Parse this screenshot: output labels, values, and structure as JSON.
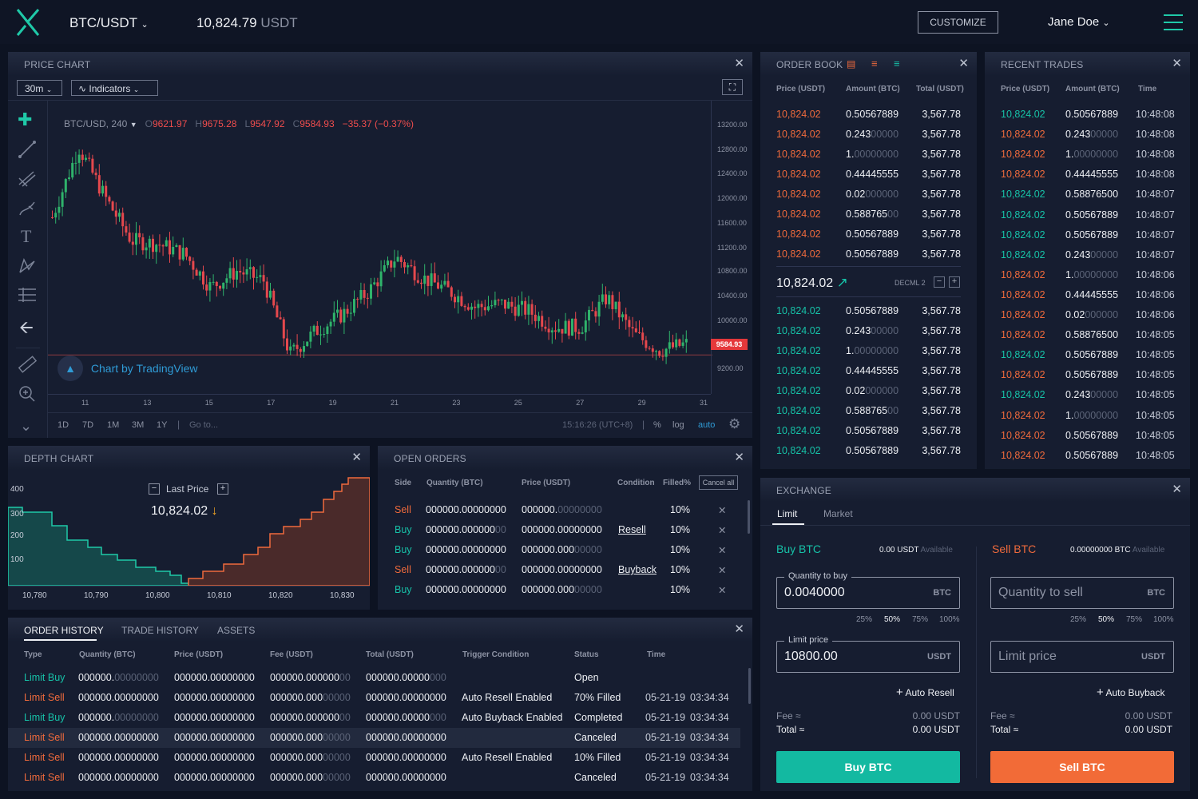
{
  "topbar": {
    "pair": "BTC/USDT",
    "price": "10,824.79",
    "currency": "USDT",
    "customize": "CUSTOMIZE",
    "user": "Jane Doe"
  },
  "price_chart": {
    "title": "PRICE CHART",
    "interval": "30m",
    "indicators": "Indicators",
    "symbol": "BTC/USD, 240",
    "o_label": "O",
    "o": "9621.97",
    "h_label": "H",
    "h": "9675.28",
    "l_label": "L",
    "l": "9547.92",
    "c_label": "C",
    "c": "9584.93",
    "change": "−35.37 (−0.37%)",
    "last_tag": "9584.93",
    "watermark": "Chart by TradingView",
    "ranges": [
      "1D",
      "7D",
      "1M",
      "3M",
      "1Y"
    ],
    "goto": "Go to...",
    "time": "15:16:26 (UTC+8)",
    "pct": "%",
    "log": "log",
    "auto": "auto",
    "y_ticks": [
      "13200.00",
      "12800.00",
      "12400.00",
      "12000.00",
      "11600.00",
      "11200.00",
      "10800.00",
      "10400.00",
      "10000.00",
      "9200.00"
    ],
    "x_ticks": [
      "11",
      "13",
      "15",
      "17",
      "19",
      "21",
      "23",
      "25",
      "27",
      "29",
      "31"
    ]
  },
  "order_book": {
    "title": "ORDER BOOK",
    "headers": [
      "Price (USDT)",
      "Amount (BTC)",
      "Total (USDT)"
    ],
    "asks": [
      [
        "10,824.02",
        "0.50567889",
        "",
        "3,567.78"
      ],
      [
        "10,824.02",
        "0.243",
        "00000",
        "3,567.78"
      ],
      [
        "10,824.02",
        "1.",
        "00000000",
        "3,567.78"
      ],
      [
        "10,824.02",
        "0.44445555",
        "",
        "3,567.78"
      ],
      [
        "10,824.02",
        "0.02",
        "000000",
        "3,567.78"
      ],
      [
        "10,824.02",
        "0.588765",
        "00",
        "3,567.78"
      ],
      [
        "10,824.02",
        "0.50567889",
        "",
        "3,567.78"
      ],
      [
        "10,824.02",
        "0.50567889",
        "",
        "3,567.78"
      ]
    ],
    "mid": "10,824.02",
    "decimal": "DECML 2",
    "bids": [
      [
        "10,824.02",
        "0.50567889",
        "",
        "3,567.78"
      ],
      [
        "10,824.02",
        "0.243",
        "00000",
        "3,567.78"
      ],
      [
        "10,824.02",
        "1.",
        "00000000",
        "3,567.78"
      ],
      [
        "10,824.02",
        "0.44445555",
        "",
        "3,567.78"
      ],
      [
        "10,824.02",
        "0.02",
        "000000",
        "3,567.78"
      ],
      [
        "10,824.02",
        "0.588765",
        "00",
        "3,567.78"
      ],
      [
        "10,824.02",
        "0.50567889",
        "",
        "3,567.78"
      ],
      [
        "10,824.02",
        "0.50567889",
        "",
        "3,567.78"
      ]
    ]
  },
  "recent_trades": {
    "title": "RECENT TRADES",
    "headers": [
      "Price (USDT)",
      "Amount (BTC)",
      "Time"
    ],
    "rows": [
      [
        "g",
        "10,824.02",
        "0.50567889",
        "",
        "10:48:08"
      ],
      [
        "r",
        "10,824.02",
        "0.243",
        "00000",
        "10:48:08"
      ],
      [
        "r",
        "10,824.02",
        "1.",
        "00000000",
        "10:48:08"
      ],
      [
        "r",
        "10,824.02",
        "0.44445555",
        "",
        "10:48:08"
      ],
      [
        "g",
        "10,824.02",
        "0.58876500",
        "",
        "10:48:07"
      ],
      [
        "g",
        "10,824.02",
        "0.50567889",
        "",
        "10:48:07"
      ],
      [
        "g",
        "10,824.02",
        "0.50567889",
        "",
        "10:48:07"
      ],
      [
        "g",
        "10,824.02",
        "0.243",
        "00000",
        "10:48:07"
      ],
      [
        "r",
        "10,824.02",
        "1.",
        "00000000",
        "10:48:06"
      ],
      [
        "r",
        "10,824.02",
        "0.44445555",
        "",
        "10:48:06"
      ],
      [
        "r",
        "10,824.02",
        "0.02",
        "000000",
        "10:48:06"
      ],
      [
        "r",
        "10,824.02",
        "0.58876500",
        "",
        "10:48:05"
      ],
      [
        "g",
        "10,824.02",
        "0.50567889",
        "",
        "10:48:05"
      ],
      [
        "r",
        "10,824.02",
        "0.50567889",
        "",
        "10:48:05"
      ],
      [
        "g",
        "10,824.02",
        "0.243",
        "00000",
        "10:48:05"
      ],
      [
        "r",
        "10,824.02",
        "1.",
        "00000000",
        "10:48:05"
      ],
      [
        "r",
        "10,824.02",
        "0.50567889",
        "",
        "10:48:05"
      ],
      [
        "r",
        "10,824.02",
        "0.50567889",
        "",
        "10:48:05"
      ]
    ]
  },
  "depth_chart": {
    "title": "DEPTH CHART",
    "last_label": "Last Price",
    "last": "10,824.02",
    "y_ticks": [
      "400",
      "300",
      "200",
      "100"
    ],
    "x_ticks": [
      "10,780",
      "10,790",
      "10,800",
      "10,810",
      "10,820",
      "10,830"
    ]
  },
  "open_orders": {
    "title": "OPEN ORDERS",
    "headers": [
      "Side",
      "Quantity (BTC)",
      "Price (USDT)",
      "Condition",
      "Filled%"
    ],
    "cancel_all": "Cancel all",
    "rows": [
      [
        "Sell",
        "000000.00000000",
        "",
        "000000.",
        "00000000",
        "",
        "10%"
      ],
      [
        "Buy",
        "000000.000000",
        "00",
        "000000.00000000",
        "",
        "Resell",
        "10%"
      ],
      [
        "Buy",
        "000000.00000000",
        "",
        "000000.000",
        "00000",
        "",
        "10%"
      ],
      [
        "Sell",
        "000000.000000",
        "00",
        "000000.00000000",
        "",
        "Buyback",
        "10%"
      ],
      [
        "Buy",
        "000000.00000000",
        "",
        "000000.000",
        "00000",
        "",
        "10%"
      ]
    ]
  },
  "history": {
    "tabs": [
      "ORDER HISTORY",
      "TRADE HISTORY",
      "ASSETS"
    ],
    "headers": [
      "Type",
      "Quantity (BTC)",
      "Price (USDT)",
      "Fee (USDT)",
      "Total (USDT)",
      "Trigger Condition",
      "Status",
      "Time"
    ],
    "rows": [
      [
        "g",
        "Limit Buy",
        "000000.",
        "00000000",
        "000000.00000000",
        "",
        "000000.000000",
        "00",
        "000000.00000",
        "000",
        "",
        "Open",
        "",
        ""
      ],
      [
        "r",
        "Limit Sell",
        "000000.00000000",
        "",
        "000000.00000000",
        "",
        "000000.000",
        "00000",
        "000000.00000000",
        "",
        "Auto Resell Enabled",
        "70% Filled",
        "05-21-19",
        "03:34:34"
      ],
      [
        "g",
        "Limit Buy",
        "000000.",
        "00000000",
        "000000.00000000",
        "",
        "000000.000000",
        "00",
        "000000.00000",
        "000",
        "Auto Buyback Enabled",
        "Completed",
        "05-21-19",
        "03:34:34"
      ],
      [
        "r",
        "Limit Sell",
        "000000.00000000",
        "",
        "000000.00000000",
        "",
        "000000.000",
        "00000",
        "000000.00000000",
        "",
        "",
        "Canceled",
        "05-21-19",
        "03:34:34"
      ],
      [
        "r",
        "Limit Sell",
        "000000.00000000",
        "",
        "000000.00000000",
        "",
        "000000.000",
        "00000",
        "000000.00000000",
        "",
        "Auto Resell Enabled",
        "10% Filled",
        "05-21-19",
        "03:34:34"
      ],
      [
        "r",
        "Limit Sell",
        "000000.00000000",
        "",
        "000000.00000000",
        "",
        "000000.000",
        "00000",
        "000000.00000000",
        "",
        "",
        "Canceled",
        "05-21-19",
        "03:34:34"
      ]
    ]
  },
  "exchange": {
    "title": "EXCHANGE",
    "tabs": [
      "Limit",
      "Market"
    ],
    "buy": {
      "title": "Buy BTC",
      "avail": "0.00 USDT",
      "avail_label": "Available",
      "qty_label": "Quantity to buy",
      "qty": "0.0040000",
      "qty_unit": "BTC",
      "pcts": [
        "25%",
        "50%",
        "75%",
        "100%"
      ],
      "price_label": "Limit price",
      "price": "10800.00",
      "price_unit": "USDT",
      "auto": "Auto Resell",
      "fee_label": "Fee ≈",
      "fee": "0.00 USDT",
      "total_label": "Total ≈",
      "total": "0.00 USDT",
      "button": "Buy BTC"
    },
    "sell": {
      "title": "Sell BTC",
      "avail": "0.00000000 BTC",
      "avail_label": "Available",
      "qty_placeholder": "Quantity to sell",
      "qty_unit": "BTC",
      "pcts": [
        "25%",
        "50%",
        "75%",
        "100%"
      ],
      "price_placeholder": "Limit price",
      "price_unit": "USDT",
      "auto": "Auto Buyback",
      "fee_label": "Fee ≈",
      "fee": "0.00 USDT",
      "total_label": "Total ≈",
      "total": "0.00 USDT",
      "button": "Sell BTC"
    }
  },
  "colors": {
    "bg": "#0d1322",
    "panel": "#161d30",
    "green": "#16c2a8",
    "red": "#ef6a3c",
    "accent": "#1fc9a8"
  },
  "chart_data": {
    "type": "line",
    "series": [
      {
        "values": [
          11650,
          12700,
          11950,
          11300,
          11250,
          11100,
          10600,
          10850,
          10700,
          9600,
          9950,
          10200,
          10550,
          11050,
          10750,
          10550,
          10300,
          10350,
          10250,
          10000,
          10000,
          10450,
          9900,
          9650,
          9750
        ]
      }
    ]
  }
}
